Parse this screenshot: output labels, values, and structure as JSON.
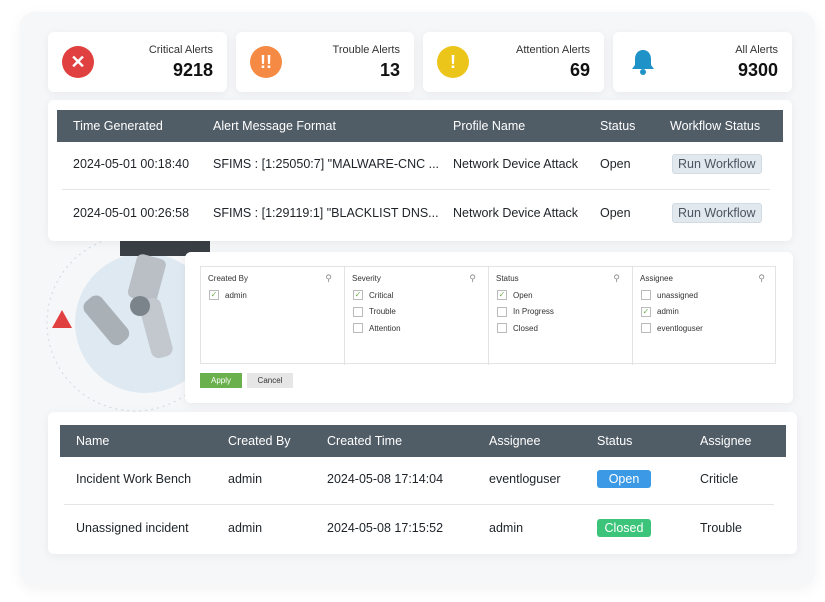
{
  "stats": [
    {
      "label": "Critical Alerts",
      "value": "9218",
      "icon": "x-icon",
      "color": "#e0403f"
    },
    {
      "label": "Trouble Alerts",
      "value": "13",
      "icon": "double-exclamation-icon",
      "color": "#f58a45"
    },
    {
      "label": "Attention Alerts",
      "value": "69",
      "icon": "exclamation-icon",
      "color": "#ecc51a"
    },
    {
      "label": "All Alerts",
      "value": "9300",
      "icon": "bell-icon",
      "color": "#1f93c7"
    }
  ],
  "alerts": {
    "headers": [
      "Time Generated",
      "Alert Message Format",
      "Profile Name",
      "Status",
      "Workflow Status"
    ],
    "rows": [
      {
        "time": "2024-05-01 00:18:40",
        "message": "SFIMS : [1:25050:7] \"MALWARE-CNC ...",
        "profile": "Network Device Attack",
        "status": "Open",
        "action": "Run Workflow"
      },
      {
        "time": "2024-05-01 00:26:58",
        "message": "SFIMS : [1:29119:1] \"BLACKLIST DNS...",
        "profile": "Network Device Attack",
        "status": "Open",
        "action": "Run Workflow"
      }
    ]
  },
  "filter": {
    "columns": [
      {
        "title": "Created By",
        "options": [
          {
            "label": "admin",
            "checked": true
          }
        ]
      },
      {
        "title": "Severity",
        "options": [
          {
            "label": "Critical",
            "checked": true
          },
          {
            "label": "Trouble",
            "checked": false
          },
          {
            "label": "Attention",
            "checked": false
          }
        ]
      },
      {
        "title": "Status",
        "options": [
          {
            "label": "Open",
            "checked": true
          },
          {
            "label": "In Progress",
            "checked": false
          },
          {
            "label": "Closed",
            "checked": false
          }
        ]
      },
      {
        "title": "Assignee",
        "options": [
          {
            "label": "unassigned",
            "checked": false
          },
          {
            "label": "admin",
            "checked": true
          },
          {
            "label": "eventloguser",
            "checked": false
          }
        ]
      }
    ],
    "apply": "Apply",
    "cancel": "Cancel"
  },
  "incidents": {
    "headers": [
      "Name",
      "Created By",
      "Created Time",
      "Assignee",
      "Status",
      "Assignee"
    ],
    "rows": [
      {
        "name": "Incident Work Bench",
        "created_by": "admin",
        "created_time": "2024-05-08 17:14:04",
        "assignee": "eventloguser",
        "status": "Open",
        "status_color": "#3b99e6",
        "severity": "Criticle"
      },
      {
        "name": "Unassigned incident",
        "created_by": "admin",
        "created_time": "2024-05-08 17:15:52",
        "assignee": "admin",
        "status": "Closed",
        "status_color": "#3cc47a",
        "severity": "Trouble"
      }
    ]
  }
}
